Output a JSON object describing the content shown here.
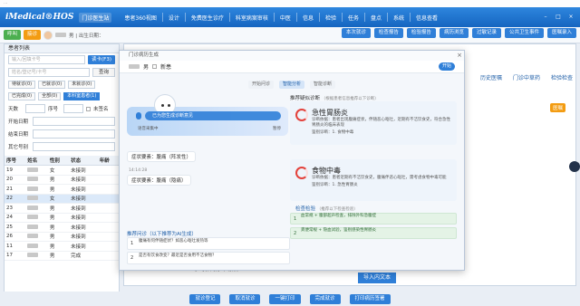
{
  "titlebar": "…",
  "nav": {
    "logo": "iMedical®HOS",
    "tag": "门诊医生站",
    "items": [
      "患者360视图",
      "设计",
      "免费医生诊疗",
      "科室病案审核",
      "中医",
      "信息",
      "检验",
      "任务",
      "盘点",
      "系统",
      "信息查看"
    ]
  },
  "patient": {
    "btn_call": "呼叫",
    "btn_receive": "接诊",
    "info": "男 | 出生日期："
  },
  "right_buttons": [
    "本次就诊",
    "检查报告",
    "检验报告",
    "病历浏览",
    "过敏记录",
    "公共卫生事件",
    "医嘱录入"
  ],
  "left": {
    "title": "患者列表",
    "card_placeholder": "输入/回填卡号",
    "read_card": "读卡(F3)",
    "name_placeholder": "姓名/登记号/卡号",
    "search": "查询",
    "filters": [
      "待就诊(0)",
      "已就诊(0)",
      "未就诊(0)"
    ],
    "filters2": [
      "已完成(0)",
      "全部(0)",
      "本科室患者(1)"
    ],
    "days_label": "天数",
    "seq_label": "序号",
    "unsigned_label": "未签名",
    "start_label": "开始日期",
    "end_label": "结束日期",
    "other_label": "其它号别",
    "table": {
      "headers": [
        "序号",
        "姓名",
        "性别",
        "状态",
        "年龄"
      ],
      "rows": [
        {
          "seq": "19",
          "sex": "女",
          "status": "未接到"
        },
        {
          "seq": "20",
          "sex": "男",
          "status": "未接到"
        },
        {
          "seq": "21",
          "sex": "男",
          "status": "未接到"
        },
        {
          "seq": "22",
          "sex": "女",
          "status": "未接到"
        },
        {
          "seq": "23",
          "sex": "男",
          "status": "未接到"
        },
        {
          "seq": "24",
          "sex": "男",
          "status": "未接到"
        },
        {
          "seq": "25",
          "sex": "男",
          "status": "未接到"
        },
        {
          "seq": "26",
          "sex": "男",
          "status": "未接到"
        },
        {
          "seq": "11",
          "sex": "男",
          "status": "未接到"
        },
        {
          "seq": "17",
          "sex": "男",
          "status": "完成"
        }
      ]
    }
  },
  "main_tabs": [
    "历史医嘱",
    "门诊中草药",
    "检验检查"
  ],
  "org_badge": "医嘱",
  "bottom_text": "20岁时(右眼手术切除)",
  "import_btn": "导入内文本",
  "bottom_buttons": [
    "就诊登记",
    "取消就诊",
    "一键打印",
    "完成就诊",
    "打印病历签署"
  ],
  "dialog": {
    "title": "门诊病历生成",
    "patient_sex": "男",
    "new_label": "新患",
    "start_btn": "开始",
    "tabs": [
      "开始问诊",
      "智能分析",
      "智能诊断"
    ],
    "voice_banner": "已为您生成诊断意见",
    "voice_sub": "语音采集中",
    "voice_sub_r": "暂停",
    "symptoms": [
      {
        "time": "",
        "text": "症状要素：腹痛（阵发性）"
      },
      {
        "time": "14:14:28",
        "text": "症状要素：腹痛（隐痛）"
      }
    ],
    "q_title": "推荐问诊（以下推荐为AI生成）",
    "questions": [
      "腹痛有何伴随症状？如恶心呕吐发热等",
      "是否有饮食改变？最近是否食用不洁食物？"
    ],
    "diag_title": "推荐疑似诊断",
    "diag_sub": "（根据患者信息推荐以下诊断）",
    "diagnoses": [
      {
        "name": "急性胃肠炎",
        "text": "诊断依据：患者出现腹痛症状，伴随恶心呕吐，近期有不洁饮食史，符合急性胃肠炎的临床表现",
        "level": "鉴别诊断：1. 食物中毒"
      },
      {
        "name": "食物中毒",
        "text": "诊断依据：患者近期有不洁饮食史，腹痛伴恶心呕吐，需考虑食物中毒可能",
        "level": "鉴别诊断：1. 急性胃肠炎"
      }
    ],
    "adv_title": "检查检验",
    "adv_sub": "（推荐以下检查检验）",
    "advice": [
      "血常规 + 腹部超声检查，排除外科急腹症",
      "粪便常规 + 隐血试验，鉴别感染性胃肠炎"
    ]
  },
  "colors": {
    "primary": "#2f7fd8",
    "nav": "#1565c0",
    "green": "#4caf50",
    "orange": "#f39c12",
    "danger": "#e3413b"
  }
}
